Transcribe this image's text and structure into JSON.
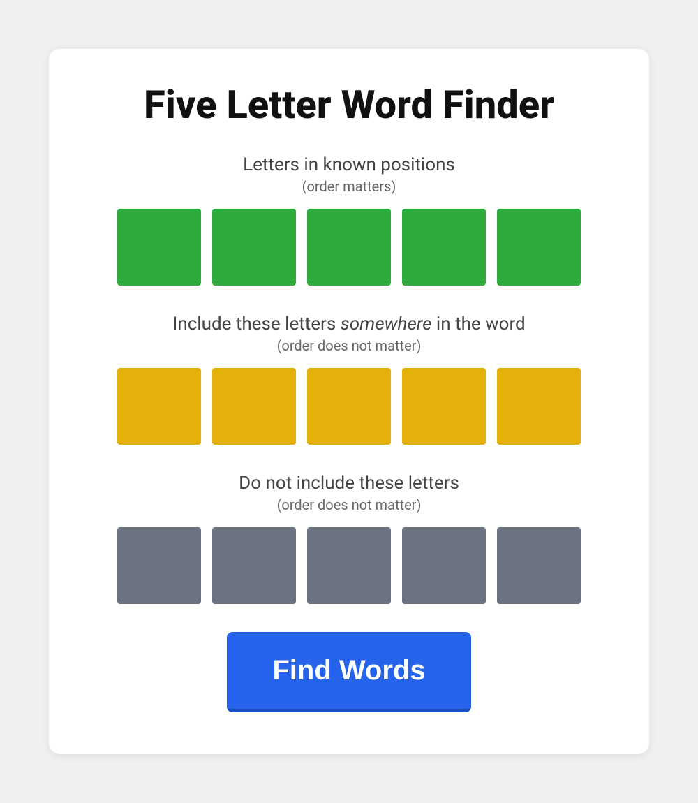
{
  "page": {
    "title": "Five Letter Word Finder"
  },
  "sections": {
    "known": {
      "label": "Letters in known positions",
      "sublabel": "(order matters)",
      "tile_color": "green",
      "tiles": [
        "",
        "",
        "",
        "",
        ""
      ]
    },
    "include": {
      "label": "Include these letters somewhere in the word",
      "sublabel": "(order does not matter)",
      "tile_color": "yellow",
      "tiles": [
        "",
        "",
        "",
        "",
        ""
      ]
    },
    "exclude": {
      "label": "Do not include these letters",
      "sublabel": "(order does not matter)",
      "tile_color": "gray",
      "tiles": [
        "",
        "",
        "",
        "",
        ""
      ]
    }
  },
  "button": {
    "label": "Find Words"
  }
}
